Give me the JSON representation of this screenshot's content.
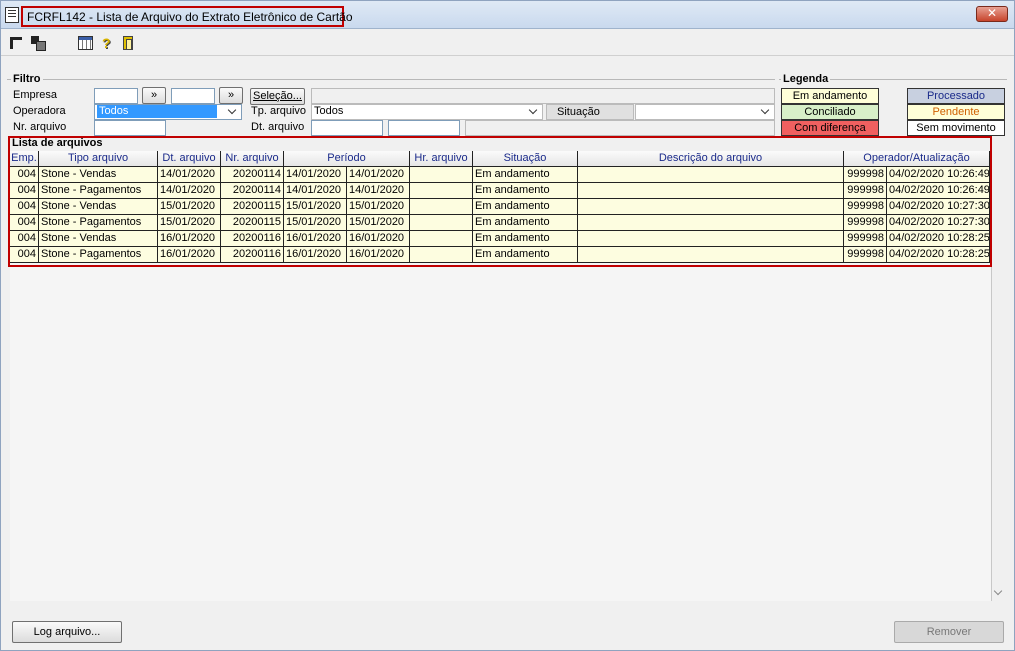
{
  "window": {
    "title": "FCRFL142 - Lista de Arquivo do Extrato Eletrônico de Cartão",
    "close_glyph": "✕"
  },
  "toolbar": {
    "help_glyph": "?"
  },
  "filtro": {
    "group_label": "Filtro",
    "empresa_label": "Empresa",
    "empresa_from": "",
    "empresa_to": "",
    "arrow1": "»",
    "arrow2": "»",
    "selecao_label": "Seleção...",
    "operadora_label": "Operadora",
    "operadora_value": "Todos",
    "tp_arquivo_label": "Tp. arquivo",
    "tp_arquivo_value": "Todos",
    "situacao_label": "Situação",
    "situacao_value": "",
    "nr_arquivo_label": "Nr. arquivo",
    "nr_arquivo_value": "",
    "dt_arquivo_label": "Dt. arquivo",
    "dt_arquivo_from": "",
    "dt_arquivo_to": ""
  },
  "legenda": {
    "group_label": "Legenda",
    "items": [
      {
        "label": "Em andamento",
        "bg": "#ffffd8",
        "fg": "#000000"
      },
      {
        "label": "Processado",
        "bg": "#c8d0e0",
        "fg": "#1a2a8a"
      },
      {
        "label": "Conciliado",
        "bg": "#d8f0c8",
        "fg": "#000000"
      },
      {
        "label": "Pendente",
        "bg": "#ffffd8",
        "fg": "#d06000"
      },
      {
        "label": "Com diferença",
        "bg": "#f06060",
        "fg": "#000000"
      },
      {
        "label": "Sem movimento",
        "bg": "#ffffff",
        "fg": "#000000"
      }
    ]
  },
  "lista": {
    "title": "Lista de arquivos",
    "columns": [
      "Emp.",
      "Tipo arquivo",
      "Dt. arquivo",
      "Nr. arquivo",
      "Período",
      "Hr. arquivo",
      "Situação",
      "Descrição do arquivo",
      "Operador/Atualização"
    ],
    "rows": [
      {
        "emp": "004",
        "tipo": "Stone - Vendas",
        "dt": "14/01/2020",
        "nr": "20200114",
        "p1": "14/01/2020",
        "p2": "14/01/2020",
        "hr": "",
        "sit": "Em andamento",
        "desc": "",
        "op": "999998",
        "atu": "04/02/2020 10:26:49"
      },
      {
        "emp": "004",
        "tipo": "Stone - Pagamentos",
        "dt": "14/01/2020",
        "nr": "20200114",
        "p1": "14/01/2020",
        "p2": "14/01/2020",
        "hr": "",
        "sit": "Em andamento",
        "desc": "",
        "op": "999998",
        "atu": "04/02/2020 10:26:49"
      },
      {
        "emp": "004",
        "tipo": "Stone - Vendas",
        "dt": "15/01/2020",
        "nr": "20200115",
        "p1": "15/01/2020",
        "p2": "15/01/2020",
        "hr": "",
        "sit": "Em andamento",
        "desc": "",
        "op": "999998",
        "atu": "04/02/2020 10:27:30"
      },
      {
        "emp": "004",
        "tipo": "Stone - Pagamentos",
        "dt": "15/01/2020",
        "nr": "20200115",
        "p1": "15/01/2020",
        "p2": "15/01/2020",
        "hr": "",
        "sit": "Em andamento",
        "desc": "",
        "op": "999998",
        "atu": "04/02/2020 10:27:30"
      },
      {
        "emp": "004",
        "tipo": "Stone - Vendas",
        "dt": "16/01/2020",
        "nr": "20200116",
        "p1": "16/01/2020",
        "p2": "16/01/2020",
        "hr": "",
        "sit": "Em andamento",
        "desc": "",
        "op": "999998",
        "atu": "04/02/2020 10:28:25"
      },
      {
        "emp": "004",
        "tipo": "Stone - Pagamentos",
        "dt": "16/01/2020",
        "nr": "20200116",
        "p1": "16/01/2020",
        "p2": "16/01/2020",
        "hr": "",
        "sit": "Em andamento",
        "desc": "",
        "op": "999998",
        "atu": "04/02/2020 10:28:25"
      }
    ]
  },
  "footer": {
    "log_label": "Log arquivo...",
    "remover_label": "Remover"
  }
}
